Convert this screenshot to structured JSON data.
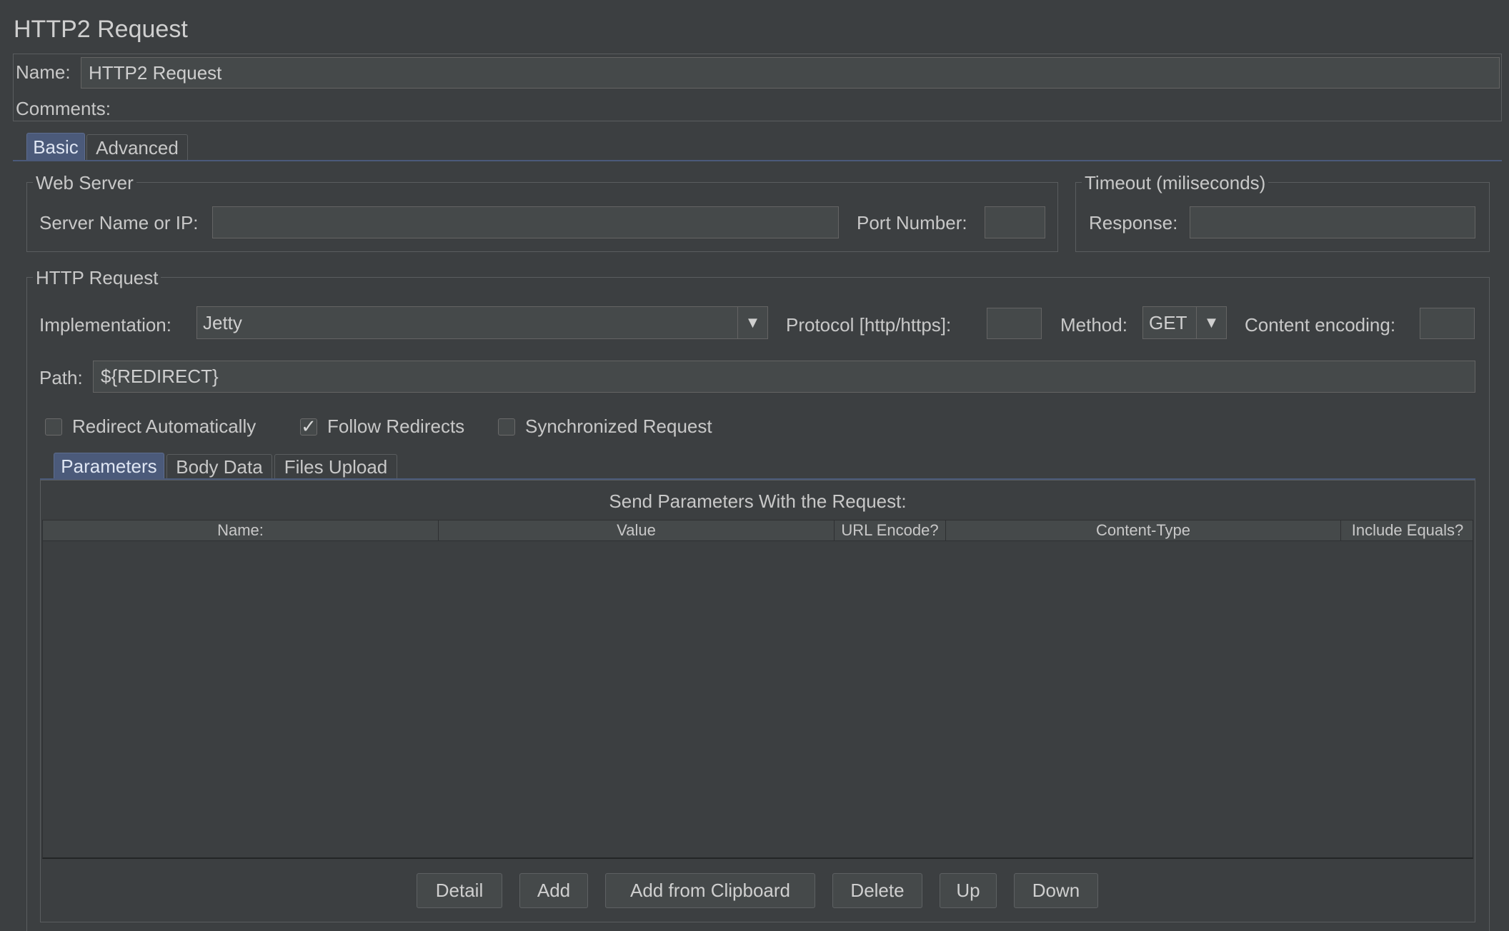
{
  "title": "HTTP2 Request",
  "name_label": "Name:",
  "name_value": "HTTP2 Request",
  "comments_label": "Comments:",
  "tabs": {
    "basic": "Basic",
    "advanced": "Advanced"
  },
  "web_server": {
    "legend": "Web Server",
    "server_label": "Server Name or IP:",
    "server_value": "",
    "port_label": "Port Number:",
    "port_value": ""
  },
  "timeout": {
    "legend": "Timeout (miliseconds)",
    "response_label": "Response:",
    "response_value": ""
  },
  "http_request": {
    "legend": "HTTP Request",
    "implementation_label": "Implementation:",
    "implementation_value": "Jetty",
    "protocol_label": "Protocol [http/https]:",
    "protocol_value": "",
    "method_label": "Method:",
    "method_value": "GET",
    "encoding_label": "Content encoding:",
    "encoding_value": "",
    "path_label": "Path:",
    "path_value": "${REDIRECT}"
  },
  "checkboxes": [
    {
      "label": "Redirect Automatically",
      "checked": false
    },
    {
      "label": "Follow Redirects",
      "checked": true
    },
    {
      "label": "Synchronized Request",
      "checked": false
    }
  ],
  "sub_tabs": {
    "parameters": "Parameters",
    "body_data": "Body Data",
    "files_upload": "Files Upload"
  },
  "params": {
    "heading": "Send Parameters With the Request:",
    "columns": [
      "Name:",
      "Value",
      "URL Encode?",
      "Content-Type",
      "Include Equals?"
    ]
  },
  "buttons": {
    "detail": "Detail",
    "add": "Add",
    "add_clipboard": "Add from Clipboard",
    "delete": "Delete",
    "up": "Up",
    "down": "Down"
  },
  "icons": {
    "dropdown": "chevron-down-icon",
    "check": "checkmark-icon"
  }
}
